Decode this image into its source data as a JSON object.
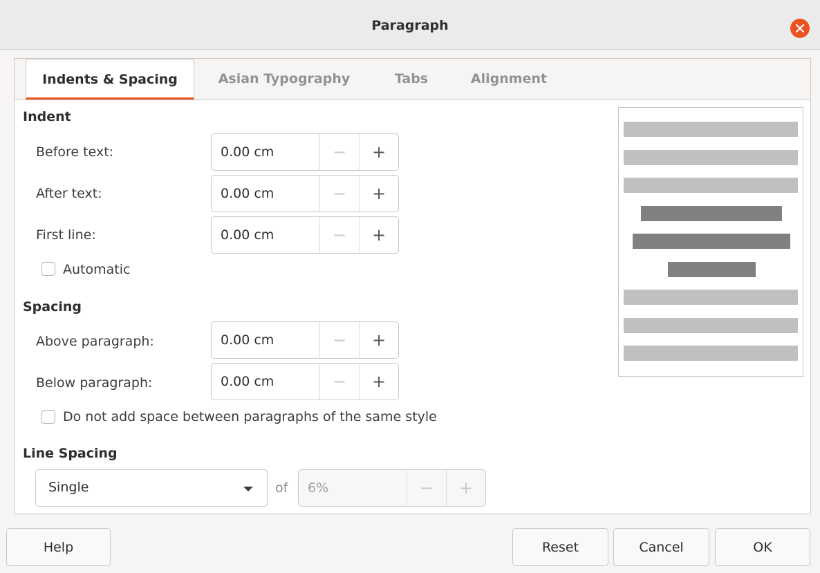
{
  "window": {
    "title": "Paragraph"
  },
  "tabs": [
    {
      "label": "Indents & Spacing",
      "active": true
    },
    {
      "label": "Asian Typography",
      "active": false
    },
    {
      "label": "Tabs",
      "active": false
    },
    {
      "label": "Alignment",
      "active": false
    }
  ],
  "indent": {
    "heading": "Indent",
    "before_text": {
      "label": "Before text:",
      "value": "0.00 cm"
    },
    "after_text": {
      "label": "After text:",
      "value": "0.00 cm"
    },
    "first_line": {
      "label": "First line:",
      "value": "0.00 cm"
    },
    "automatic": {
      "label": "Automatic",
      "checked": false
    }
  },
  "spacing": {
    "heading": "Spacing",
    "above": {
      "label": "Above paragraph:",
      "value": "0.00 cm"
    },
    "below": {
      "label": "Below paragraph:",
      "value": "0.00 cm"
    },
    "no_space_same_style": {
      "label": "Do not add space between paragraphs of the same style",
      "checked": false
    }
  },
  "line_spacing": {
    "heading": "Line Spacing",
    "selected": "Single",
    "of_label": "of",
    "value": "6%"
  },
  "spin_glyphs": {
    "minus": "−",
    "plus": "+"
  },
  "buttons": {
    "help": "Help",
    "reset": "Reset",
    "cancel": "Cancel",
    "ok": "OK"
  },
  "colors": {
    "accent": "#e95420",
    "preview_light": "#c0c0c0",
    "preview_dark": "#808080"
  }
}
